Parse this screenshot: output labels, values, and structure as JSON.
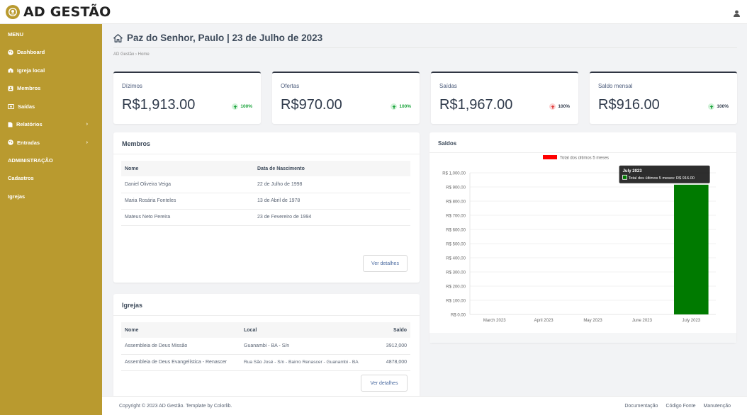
{
  "app": {
    "logo_text": "AD GESTÃO"
  },
  "sidebar": {
    "menu_heading": "MENU",
    "items": [
      {
        "label": "Dashboard",
        "icon": "palette-icon"
      },
      {
        "label": "Igreja local",
        "icon": "church-icon"
      },
      {
        "label": "Membros",
        "icon": "id-card-icon"
      },
      {
        "label": "Saídas",
        "icon": "money-icon"
      },
      {
        "label": "Relatórios",
        "icon": "file-icon",
        "chevron": "›"
      },
      {
        "label": "Entradas",
        "icon": "palette-icon",
        "chevron": "›"
      }
    ],
    "admin_heading": "ADMINISTRAÇÃO",
    "admin_items": [
      {
        "label": "Cadastros"
      },
      {
        "label": "Igrejas"
      }
    ]
  },
  "header": {
    "title": "Paz do Senhor, Paulo | 23 de Julho de 2023",
    "breadcrumb": "AD Gestão  ›  Home"
  },
  "stats": [
    {
      "label": "Dízimos",
      "value": "R$1,913.00",
      "trend": "100%",
      "direction": "up",
      "color": "#19a33a"
    },
    {
      "label": "Ofertas",
      "value": "R$970.00",
      "trend": "100%",
      "direction": "up",
      "color": "#19a33a"
    },
    {
      "label": "Saídas",
      "value": "R$1,967.00",
      "trend": "100%",
      "direction": "up",
      "color": "#e03a3a"
    },
    {
      "label": "Saldo mensal",
      "value": "R$916.00",
      "trend": "100%",
      "direction": "up",
      "color": "#19a33a"
    }
  ],
  "members": {
    "title": "Membros",
    "columns": [
      "Nome",
      "Data de Nascimento"
    ],
    "rows": [
      [
        "Daniel Oliveira Veiga",
        "22 de Julho de 1998"
      ],
      [
        "Maria Rosária Fonteles",
        "13 de Abril de 1978"
      ],
      [
        "Mateus Neto Pereira",
        "23 de Fevereiro de 1994"
      ]
    ],
    "button": "Ver detalhes"
  },
  "churches": {
    "title": "Igrejas",
    "columns": [
      "Nome",
      "Local",
      "Saldo"
    ],
    "rows": [
      [
        "Assembleia de Deus Missão",
        "Guanambi - BA - S/n",
        "3912,000"
      ],
      [
        "Assembleia de Deus Evangelística - Renascer",
        "Rua São José - S/n - Bairro Renascer - Guanambi - BA",
        "4878,000"
      ]
    ],
    "button": "Ver detalhes"
  },
  "balances": {
    "title": "Saldos"
  },
  "chart_data": {
    "type": "bar",
    "categories": [
      "March 2023",
      "April 2023",
      "May 2023",
      "June 2023",
      "July 2023"
    ],
    "series": [
      {
        "name": "Total dos últimos 5 meses",
        "values": [
          0,
          0,
          0,
          0,
          916.0
        ],
        "color": "#007a00",
        "legend_color": "#ff0000"
      }
    ],
    "yticks": [
      "R$ 0.00",
      "R$ 100.00",
      "R$ 200.00",
      "R$ 300.00",
      "R$ 400.00",
      "R$ 500.00",
      "R$ 600.00",
      "R$ 700.00",
      "R$ 800.00",
      "R$ 900.00",
      "R$ 1,000.00"
    ],
    "ylim": [
      0,
      1000
    ],
    "legend_position": "top",
    "tooltip": {
      "title": "July 2023",
      "text": "Total dos últimos 5 meses: R$ 916.00"
    }
  },
  "footer": {
    "copyright": "Copyright © 2023 AD Gestão. Template by Colorlib.",
    "links": [
      "Documentação",
      "Código Fonte",
      "Manutenção"
    ]
  }
}
